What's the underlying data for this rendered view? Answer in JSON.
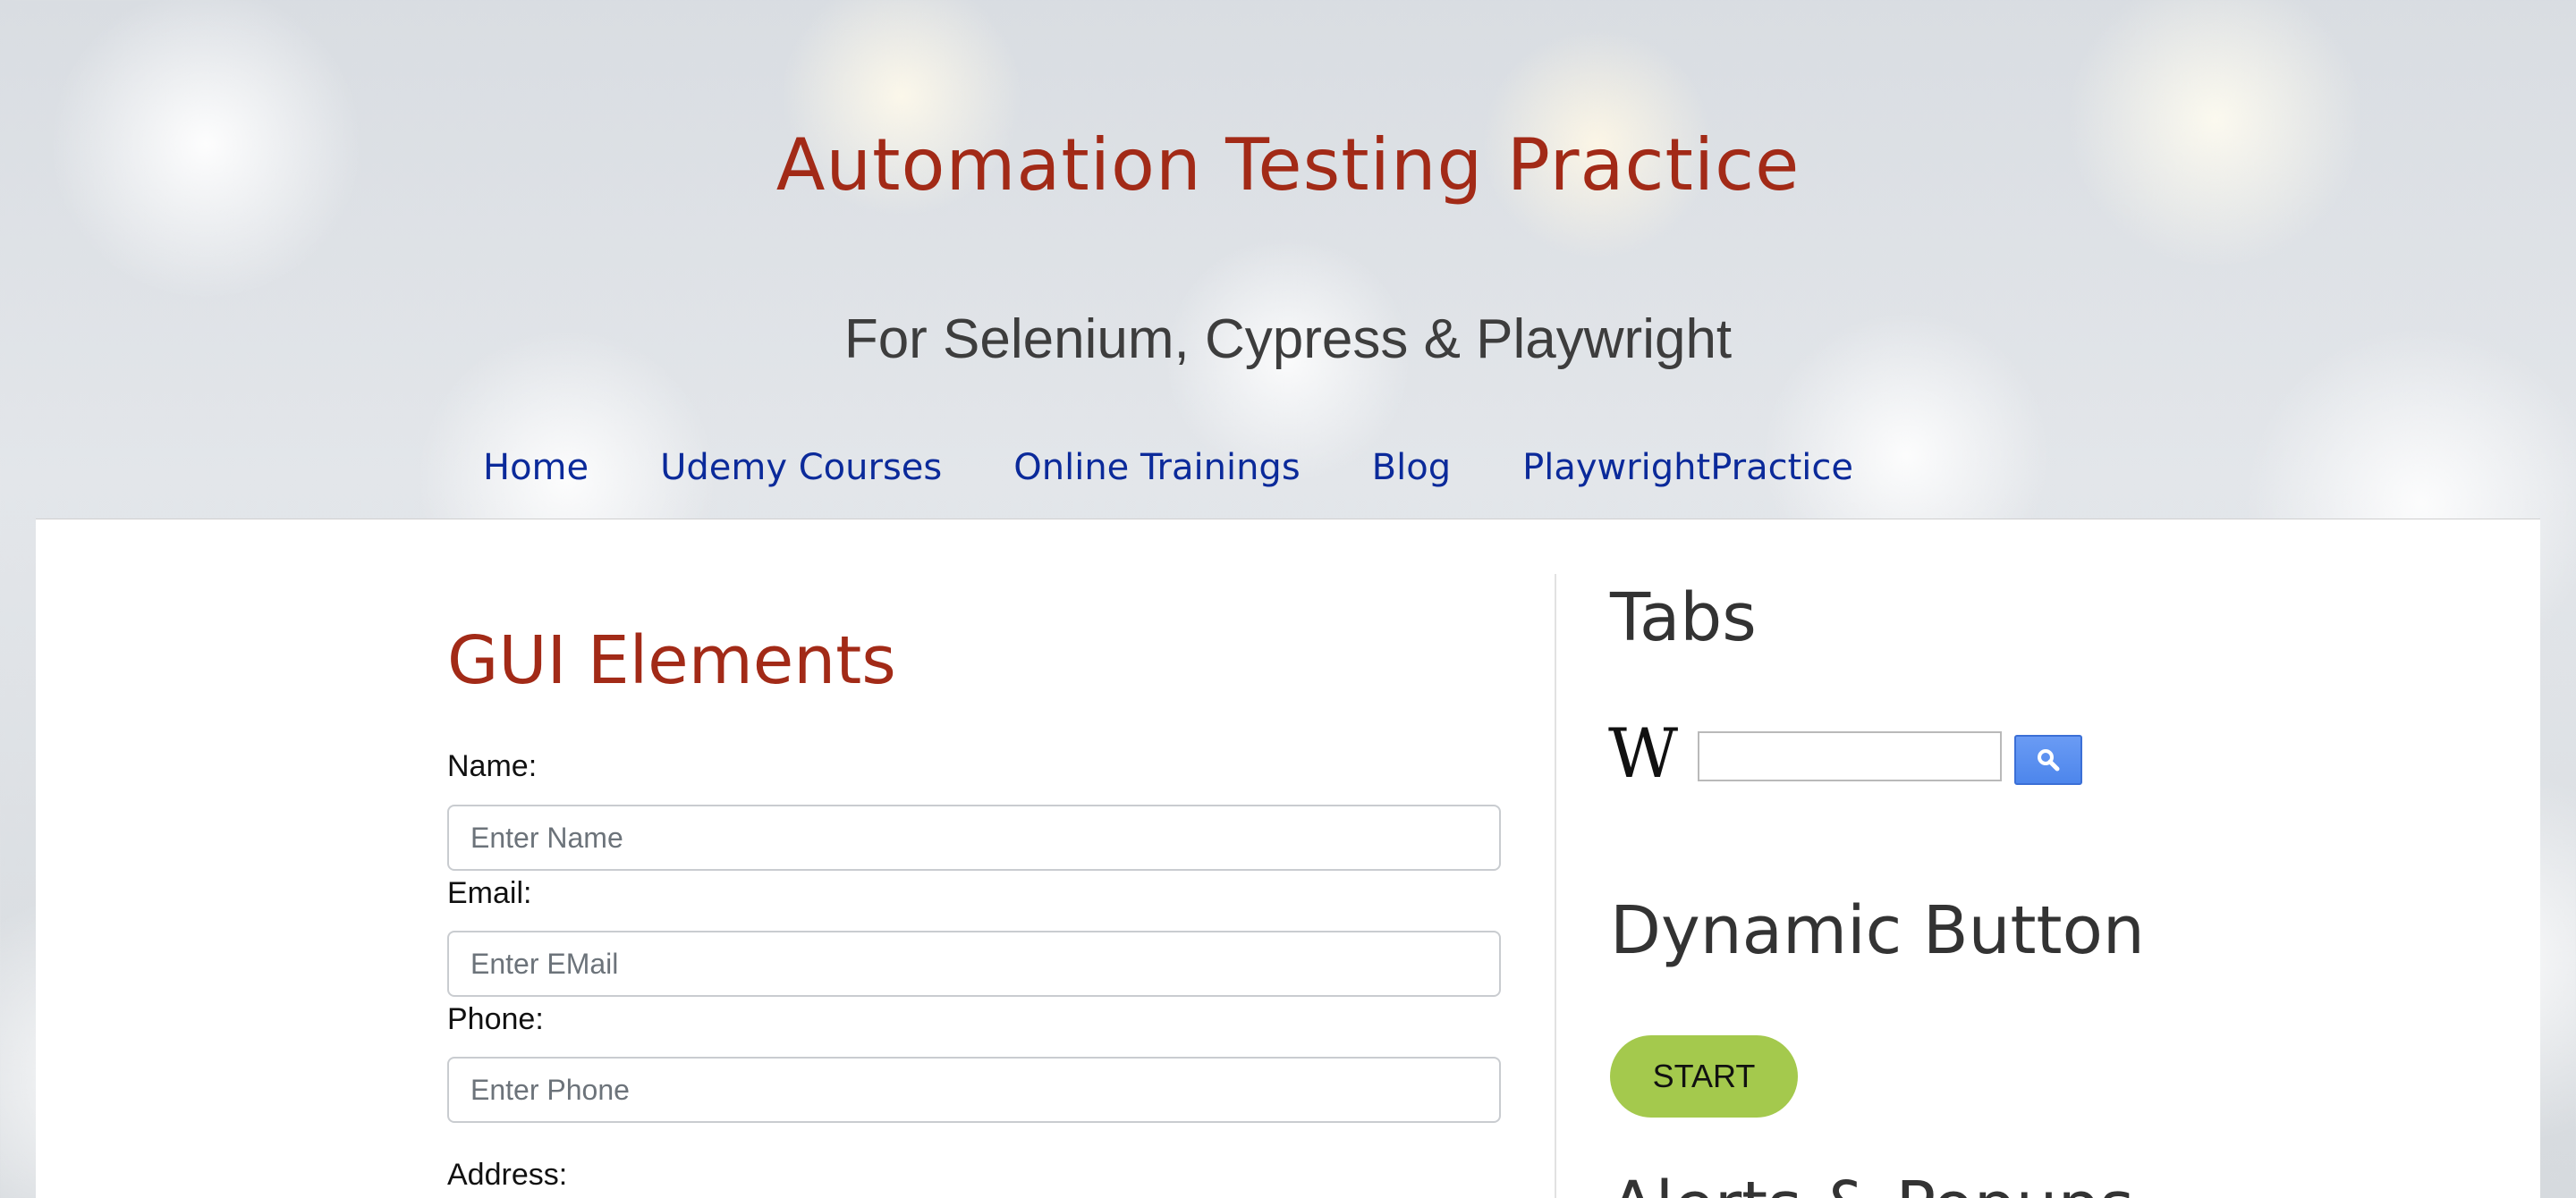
{
  "header": {
    "title": "Automation Testing Practice",
    "tagline": "For Selenium, Cypress & Playwright"
  },
  "nav": {
    "items": [
      {
        "label": "Home"
      },
      {
        "label": "Udemy Courses"
      },
      {
        "label": "Online Trainings"
      },
      {
        "label": "Blog"
      },
      {
        "label": "PlaywrightPractice"
      }
    ]
  },
  "gui_elements": {
    "heading": "GUI Elements",
    "name": {
      "label": "Name:",
      "placeholder": "Enter Name",
      "value": ""
    },
    "email": {
      "label": "Email:",
      "placeholder": "Enter EMail",
      "value": ""
    },
    "phone": {
      "label": "Phone:",
      "placeholder": "Enter Phone",
      "value": ""
    },
    "address": {
      "label": "Address:"
    }
  },
  "sidebar": {
    "tabs_heading": "Tabs",
    "wiki_logo": "W",
    "wiki_search": {
      "value": "",
      "icon": "search-icon"
    },
    "dynamic_button_heading": "Dynamic Button",
    "start_button": "START",
    "alerts_heading": "Alerts & Popups"
  },
  "colors": {
    "title": "#a22a17",
    "nav_link": "#0b2a9a",
    "start_button": "#a4c94d",
    "search_button": "#4d86ec"
  }
}
